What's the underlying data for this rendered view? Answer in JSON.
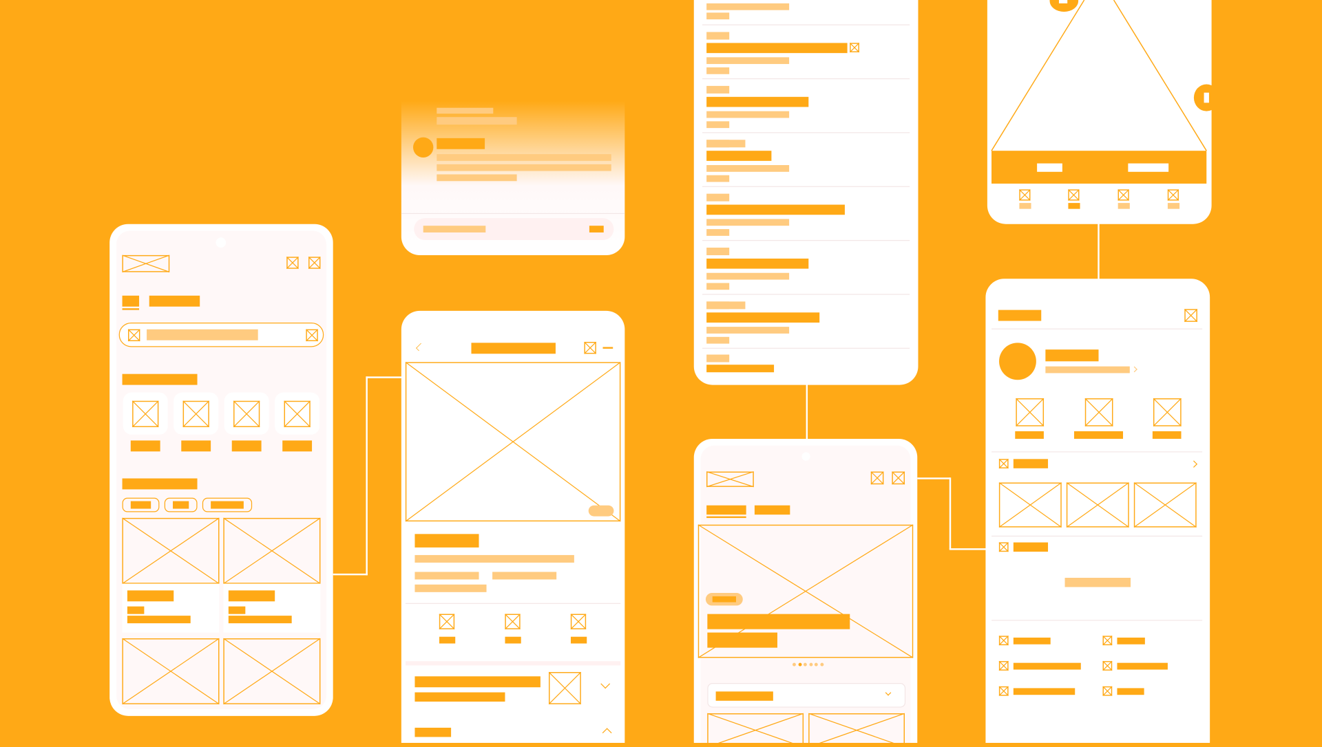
{
  "colors": {
    "background": "#FFA916",
    "accent": "#FFA916",
    "accent_light": "#FFCB80",
    "phone": "#FFFFFF",
    "screen_tint": "#FFF8F8"
  },
  "screens": [
    "home",
    "notification",
    "product-detail",
    "list",
    "carousel-detail",
    "media-viewer",
    "profile"
  ],
  "carousel": {
    "page_count": 6,
    "active_index": 1
  }
}
